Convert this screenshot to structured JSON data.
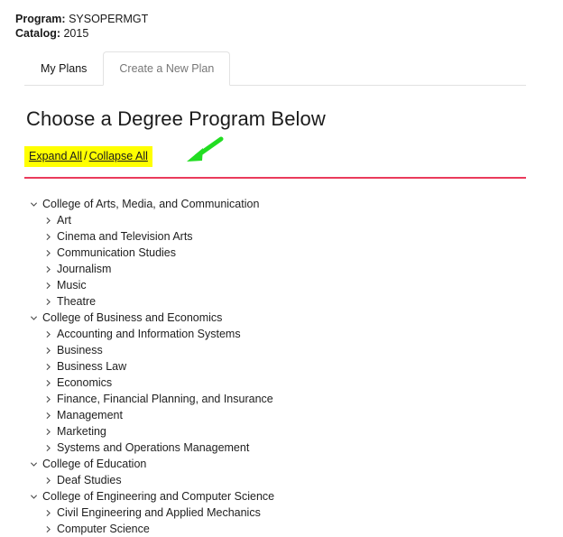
{
  "header": {
    "program_label": "Program:",
    "program_value": "SYSOPERMGT",
    "catalog_label": "Catalog:",
    "catalog_value": "2015"
  },
  "tabs": [
    {
      "label": "My Plans",
      "active": false
    },
    {
      "label": "Create a New Plan",
      "active": true
    }
  ],
  "main": {
    "title": "Choose a Degree Program Below",
    "expand_all": "Expand All",
    "separator": "/",
    "collapse_all": "Collapse All",
    "divider_color": "#ea3b5c",
    "highlight_color": "#ffff00",
    "annotation_arrow_color": "#22dd22"
  },
  "tree": [
    {
      "label": "College of Arts, Media, and Communication",
      "expanded": true,
      "children": [
        "Art",
        "Cinema and Television Arts",
        "Communication Studies",
        "Journalism",
        "Music",
        "Theatre"
      ]
    },
    {
      "label": "College of Business and Economics",
      "expanded": true,
      "children": [
        "Accounting and Information Systems",
        "Business",
        "Business Law",
        "Economics",
        "Finance, Financial Planning, and Insurance",
        "Management",
        "Marketing",
        "Systems and Operations Management"
      ]
    },
    {
      "label": "College of Education",
      "expanded": true,
      "children": [
        "Deaf Studies"
      ]
    },
    {
      "label": "College of Engineering and Computer Science",
      "expanded": true,
      "children": [
        "Civil Engineering and Applied Mechanics",
        "Computer Science"
      ]
    }
  ]
}
